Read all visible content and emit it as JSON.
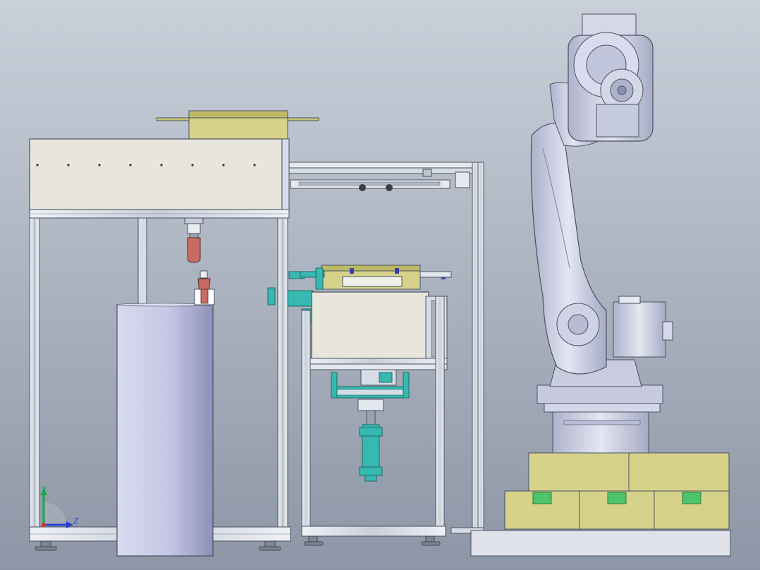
{
  "viewport": {
    "background_top": "#c9d0da",
    "background_bottom": "#8d96a6"
  },
  "colors": {
    "frame": "#d7dde6",
    "frame_edge": "#4a5160",
    "panel": "#e8e5dc",
    "olive": "#d6d28a",
    "olive_dark": "#8f8a3a",
    "cylinder": "#c4c6e4",
    "cylinder_shade": "#9a9bc4",
    "teal": "#37b8b0",
    "robot": "#cfd2e6",
    "robot_shade": "#9ea3c0",
    "crate_green": "#4ec46a",
    "part_red": "#c86b62"
  },
  "triad": {
    "y_label": "Y",
    "z_label": "Z",
    "y_icon": "axis-y-arrow",
    "z_icon": "axis-z-arrow",
    "y_color": "#1aa84a",
    "z_color": "#2a3fd6"
  }
}
